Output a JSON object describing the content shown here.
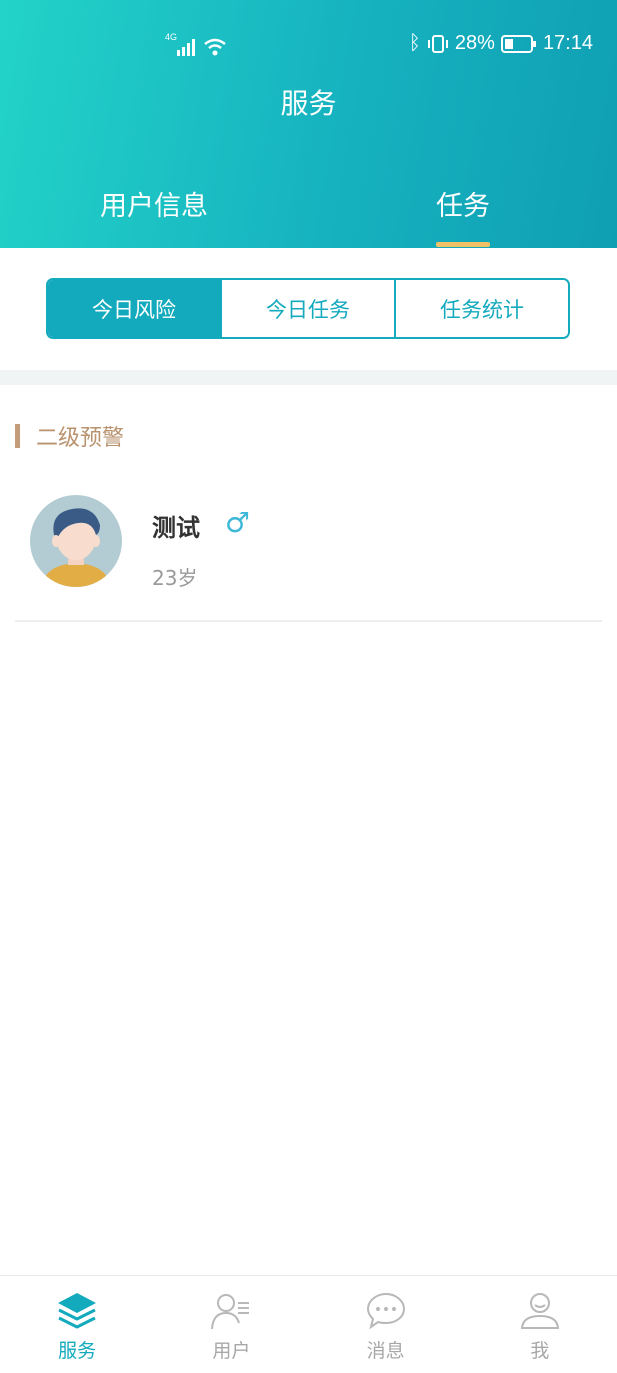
{
  "status": {
    "network": "4G",
    "battery": "28%",
    "time": "17:14"
  },
  "header": {
    "title": "服务"
  },
  "tabs": [
    {
      "label": "用户信息"
    },
    {
      "label": "任务",
      "active": true
    }
  ],
  "segments": [
    {
      "label": "今日风险",
      "active": true
    },
    {
      "label": "今日任务"
    },
    {
      "label": "任务统计"
    }
  ],
  "section": {
    "title": "二级预警"
  },
  "users": [
    {
      "name": "测试",
      "gender_symbol": "♂",
      "age": "23岁"
    }
  ],
  "bottom_nav": [
    {
      "label": "服务",
      "icon": "layers-icon",
      "active": true
    },
    {
      "label": "用户",
      "icon": "user-list-icon"
    },
    {
      "label": "消息",
      "icon": "chat-bubble-icon"
    },
    {
      "label": "我",
      "icon": "person-icon"
    }
  ],
  "colors": {
    "accent": "#13aabd",
    "header_start": "#23d3c8",
    "header_end": "#0f9fb3",
    "tab_underline": "#f0c165",
    "section_title": "#b9926e"
  }
}
